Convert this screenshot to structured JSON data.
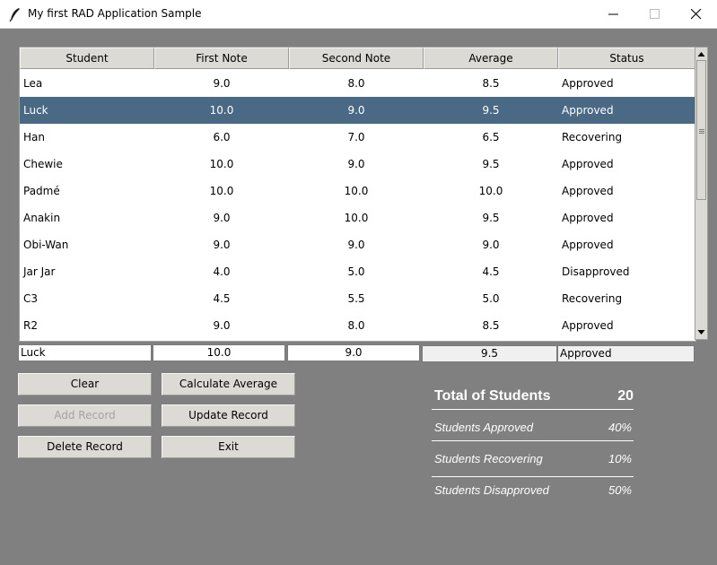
{
  "window": {
    "title": "My first RAD Application Sample",
    "icons": [
      "feather-icon",
      "minimize-icon",
      "maximize-icon",
      "close-icon"
    ]
  },
  "table": {
    "columns": [
      "Student",
      "First Note",
      "Second Note",
      "Average",
      "Status"
    ],
    "rows": [
      [
        "Lea",
        "9.0",
        "8.0",
        "8.5",
        "Approved"
      ],
      [
        "Luck",
        "10.0",
        "9.0",
        "9.5",
        "Approved"
      ],
      [
        "Han",
        "6.0",
        "7.0",
        "6.5",
        "Recovering"
      ],
      [
        "Chewie",
        "10.0",
        "9.0",
        "9.5",
        "Approved"
      ],
      [
        "Padmé",
        "10.0",
        "10.0",
        "10.0",
        "Approved"
      ],
      [
        "Anakin",
        "9.0",
        "10.0",
        "9.5",
        "Approved"
      ],
      [
        "Obi-Wan",
        "9.0",
        "9.0",
        "9.0",
        "Approved"
      ],
      [
        "Jar Jar",
        "4.0",
        "5.0",
        "4.5",
        "Disapproved"
      ],
      [
        "C3",
        "4.5",
        "5.5",
        "5.0",
        "Recovering"
      ],
      [
        "R2",
        "9.0",
        "8.0",
        "8.5",
        "Approved"
      ]
    ],
    "selected_row": 1,
    "selected_color": "#4a6984"
  },
  "entry": {
    "student": "Luck",
    "first_note": "10.0",
    "second_note": "9.0",
    "average": "9.5",
    "status": "Approved"
  },
  "buttons": {
    "clear": "Clear",
    "calculate_average": "Calculate Average",
    "add_record": "Add Record",
    "update_record": "Update Record",
    "delete_record": "Delete Record",
    "exit": "Exit"
  },
  "summary": {
    "total_label": "Total of Students",
    "total_value": "20",
    "approved_label": "Students Approved",
    "approved_value": "40%",
    "recovering_label": "Students Recovering",
    "recovering_value": "10%",
    "disapproved_label": "Students Disapproved",
    "disapproved_value": "50%"
  },
  "colors": {
    "background": "#808080",
    "button_face": "#dcdad5"
  }
}
